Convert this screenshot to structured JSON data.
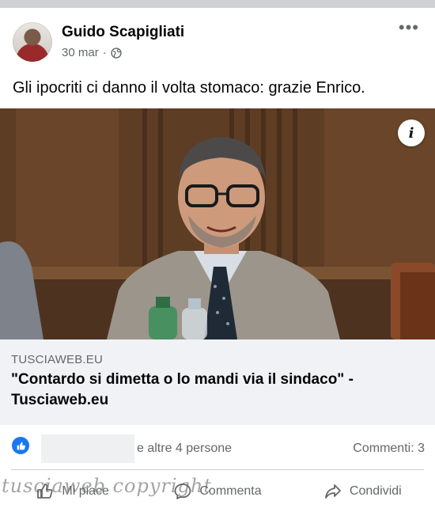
{
  "post": {
    "author": "Guido Scapigliati",
    "date": "30 mar",
    "separator": "·",
    "privacy_icon": "globe-icon",
    "more_icon": "more-options-icon",
    "text": "Gli ipocriti ci danno il volta stomaco: grazie Enrico."
  },
  "media": {
    "info_label": "i"
  },
  "link": {
    "domain": "TUSCIAWEB.EU",
    "title": "\"Contardo si dimetta o lo mandi via il sindaco\" - Tusciaweb.eu"
  },
  "reactions": {
    "icon": "like-icon",
    "summary": "e altre 4 persone",
    "comments": "Commenti: 3"
  },
  "actions": {
    "like": "Mi piace",
    "comment": "Commenta",
    "share": "Condividi"
  },
  "watermark": "tusciaweb copyright",
  "colors": {
    "brand_blue": "#1877f2",
    "secondary_text": "#65676b",
    "link_bg": "#f0f2f5"
  }
}
